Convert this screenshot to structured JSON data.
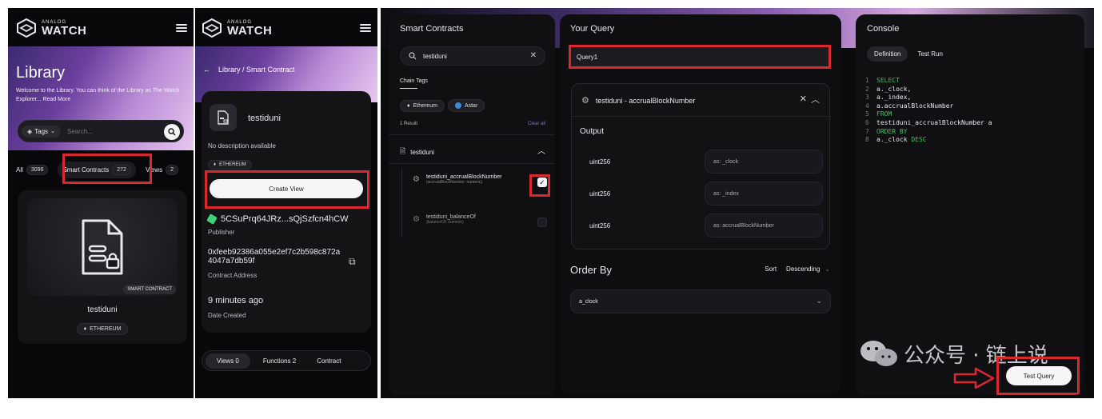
{
  "panel1": {
    "brand_small": "ANALOG",
    "brand_big": "WATCH",
    "hero_title": "Library",
    "hero_desc": "Welcome to the Library. You can think of the Library as The Watch Explorer... Read More",
    "tags_label": "Tags",
    "search_placeholder": "Search...",
    "tabs": [
      {
        "label": "All",
        "count": "3096"
      },
      {
        "label": "Smart Contracts",
        "count": "272"
      },
      {
        "label": "Views",
        "count": "2"
      }
    ],
    "card_badge": "SMART CONTRACT",
    "card_title": "testiduni",
    "card_chain": "ETHEREUM"
  },
  "panel2": {
    "brand_small": "ANALOG",
    "brand_big": "WATCH",
    "breadcrumb": "Library / Smart Contract",
    "contract_name": "testiduni",
    "no_desc": "No description available",
    "chain": "ETHEREUM",
    "create_view": "Create View",
    "publisher_value": "5CSuPrq64JRz...sQjSzfcn4hCW",
    "publisher_label": "Publisher",
    "address_value": "0xfeeb92386a055e2ef7c2b598c872a4047a7db59f",
    "address_label": "Contract Address",
    "date_value": "9 minutes ago",
    "date_label": "Date Created",
    "bottom_tabs": [
      "Views 0",
      "Functions 2",
      "Contract"
    ]
  },
  "panel3": {
    "title": "Smart Contracts",
    "search_value": "testiduni",
    "chain_tags_label": "Chain Tags",
    "chain_chips": [
      "Ethereum",
      "Astar"
    ],
    "result_count": "1 Result",
    "clear_all": "Clear all",
    "group_name": "testiduni",
    "functions": [
      {
        "name": "testiduni_accrualBlockNumber",
        "sub": "(accrualBlockNumber: numeric)",
        "checked": true
      },
      {
        "name": "testiduni_balanceOf",
        "sub": "(balanceOf: numeric)",
        "checked": false
      }
    ]
  },
  "panel4": {
    "title": "Your Query",
    "query_name": "Query1",
    "function_title": "testiduni - accrualBlockNumber",
    "output_label": "Output",
    "outputs": [
      {
        "type": "uint256",
        "alias": "as: _clock"
      },
      {
        "type": "uint256",
        "alias": "as: _index"
      },
      {
        "type": "uint256",
        "alias": "as: accrualBlockNumber"
      }
    ],
    "order_by_label": "Order By",
    "sort_label": "Sort",
    "sort_value": "Descending",
    "order_field": "a_clock"
  },
  "panel5": {
    "title": "Console",
    "tabs": [
      "Definition",
      "Test Run"
    ],
    "code_lines": [
      {
        "n": "1",
        "text": "SELECT",
        "kw": true
      },
      {
        "n": "2",
        "text": "a._clock,",
        "kw": false
      },
      {
        "n": "3",
        "text": "a._index,",
        "kw": false
      },
      {
        "n": "4",
        "text": "a.accrualBlockNumber",
        "kw": false
      },
      {
        "n": "5",
        "text": "FROM",
        "kw": true
      },
      {
        "n": "6",
        "text": "testiduni_accrualBlockNumber a",
        "kw": false
      },
      {
        "n": "7",
        "text": "ORDER BY",
        "kw": true
      },
      {
        "n": "8",
        "text": "a._clock",
        "kw": false,
        "suffix": " DESC"
      }
    ],
    "test_query": "Test Query",
    "watermark": "公众号 · 链上说"
  }
}
